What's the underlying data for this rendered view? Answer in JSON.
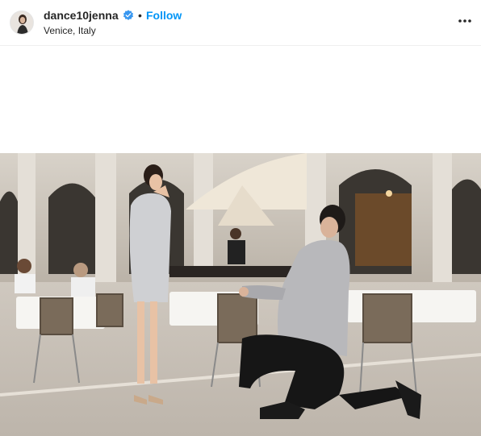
{
  "post": {
    "username": "dance10jenna",
    "separator": "•",
    "follow_label": "Follow",
    "location": "Venice, Italy",
    "verified": true,
    "icons": {
      "verified": "verified-badge-icon",
      "more": "more-options-icon"
    },
    "colors": {
      "follow": "#0095f6",
      "verified": "#3897f0",
      "text": "#262626"
    }
  }
}
